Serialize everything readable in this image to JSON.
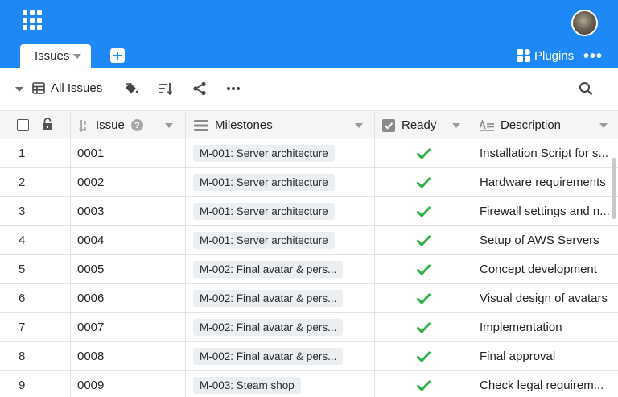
{
  "header": {
    "tabs": [
      {
        "label": "Issues"
      }
    ],
    "plugins_label": "Plugins"
  },
  "toolbar": {
    "view_label": "All Issues",
    "icons": [
      "paint-bucket-icon",
      "sort-icon",
      "share-icon",
      "more-icon",
      "search-icon"
    ]
  },
  "table": {
    "columns": [
      {
        "label": "Issue"
      },
      {
        "label": "Milestones"
      },
      {
        "label": "Ready"
      },
      {
        "label": "Description"
      }
    ],
    "issue_help_glyph": "?",
    "rows": [
      {
        "num": "1",
        "issue": "0001",
        "milestone": "M-001: Server architecture",
        "ready": true,
        "description": "Installation Script for s..."
      },
      {
        "num": "2",
        "issue": "0002",
        "milestone": "M-001: Server architecture",
        "ready": true,
        "description": "Hardware requirements"
      },
      {
        "num": "3",
        "issue": "0003",
        "milestone": "M-001: Server architecture",
        "ready": true,
        "description": "Firewall settings and n..."
      },
      {
        "num": "4",
        "issue": "0004",
        "milestone": "M-001: Server architecture",
        "ready": true,
        "description": "Setup of AWS Servers"
      },
      {
        "num": "5",
        "issue": "0005",
        "milestone": "M-002: Final avatar & pers...",
        "ready": true,
        "description": "Concept development"
      },
      {
        "num": "6",
        "issue": "0006",
        "milestone": "M-002: Final avatar & pers...",
        "ready": true,
        "description": "Visual design of avatars"
      },
      {
        "num": "7",
        "issue": "0007",
        "milestone": "M-002: Final avatar & pers...",
        "ready": true,
        "description": "Implementation"
      },
      {
        "num": "8",
        "issue": "0008",
        "milestone": "M-002: Final avatar & pers...",
        "ready": true,
        "description": "Final approval"
      },
      {
        "num": "9",
        "issue": "0009",
        "milestone": "M-003: Steam shop",
        "ready": true,
        "description": "Check legal requirem..."
      }
    ]
  },
  "colors": {
    "header_bg": "#1e88f6",
    "check_green": "#2fb344",
    "grid_line": "#e3e3e3"
  }
}
